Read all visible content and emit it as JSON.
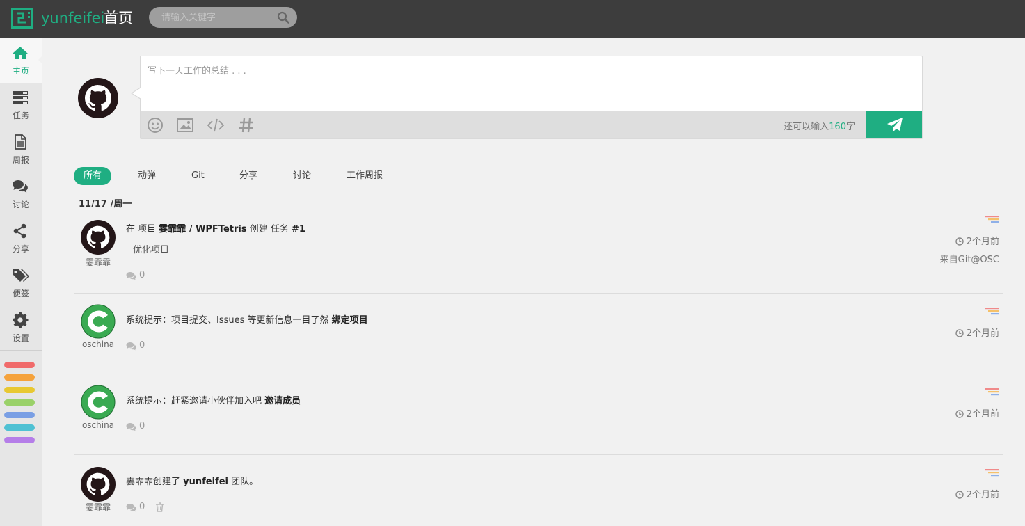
{
  "header": {
    "brand": "yunfeifei",
    "page_title": "首页",
    "search_placeholder": "请输入关键字"
  },
  "sidebar": {
    "items": [
      {
        "label": "主页",
        "icon": "home-icon",
        "active": true
      },
      {
        "label": "任务",
        "icon": "tasks-icon"
      },
      {
        "label": "周报",
        "icon": "document-icon"
      },
      {
        "label": "讨论",
        "icon": "comments-icon"
      },
      {
        "label": "分享",
        "icon": "share-icon"
      },
      {
        "label": "便签",
        "icon": "tags-icon"
      },
      {
        "label": "设置",
        "icon": "gear-icon"
      }
    ],
    "color_tags": [
      "#f06a6a",
      "#f5a23b",
      "#e8c832",
      "#9ad169",
      "#7a9fe4",
      "#4fc1d3",
      "#b57ee8"
    ]
  },
  "composer": {
    "placeholder": "写下一天工作的总结 . . .",
    "counter_prefix": "还可以输入",
    "counter_value": "160",
    "counter_suffix": "字"
  },
  "tabs": [
    "所有",
    "动弹",
    "Git",
    "分享",
    "讨论",
    "工作周报"
  ],
  "feed": {
    "date": "11/17 /周一",
    "items": [
      {
        "user": "霎霏霏",
        "avatar": "github-octocat-icon",
        "title_parts": [
          "在 项目 ",
          "霎霏霏 / WPFTetris",
          " 创建 任务 ",
          "#1"
        ],
        "desc": "优化项目",
        "comments": "0",
        "time": "2个月前",
        "source": "来自Git@OSC"
      },
      {
        "user": "oschina",
        "avatar": "oschina-logo-icon",
        "title_parts": [
          "系统提示：项目提交、Issues 等更新信息一目了然 ",
          "绑定项目"
        ],
        "comments": "0",
        "time": "2个月前"
      },
      {
        "user": "oschina",
        "avatar": "oschina-logo-icon",
        "title_parts": [
          "系统提示：赶紧邀请小伙伴加入吧 ",
          "邀请成员"
        ],
        "comments": "0",
        "time": "2个月前"
      },
      {
        "user": "霎霏霏",
        "avatar": "github-octocat-icon",
        "title_parts": [
          "霎霏霏创建了 ",
          "yunfeifei",
          " 团队。"
        ],
        "comments": "0",
        "time": "2个月前"
      }
    ]
  },
  "colors": {
    "accent": "#1fae82",
    "topbar": "#3d3d3d",
    "sidebar": "#e6e6e6",
    "background": "#f1f1f1"
  }
}
